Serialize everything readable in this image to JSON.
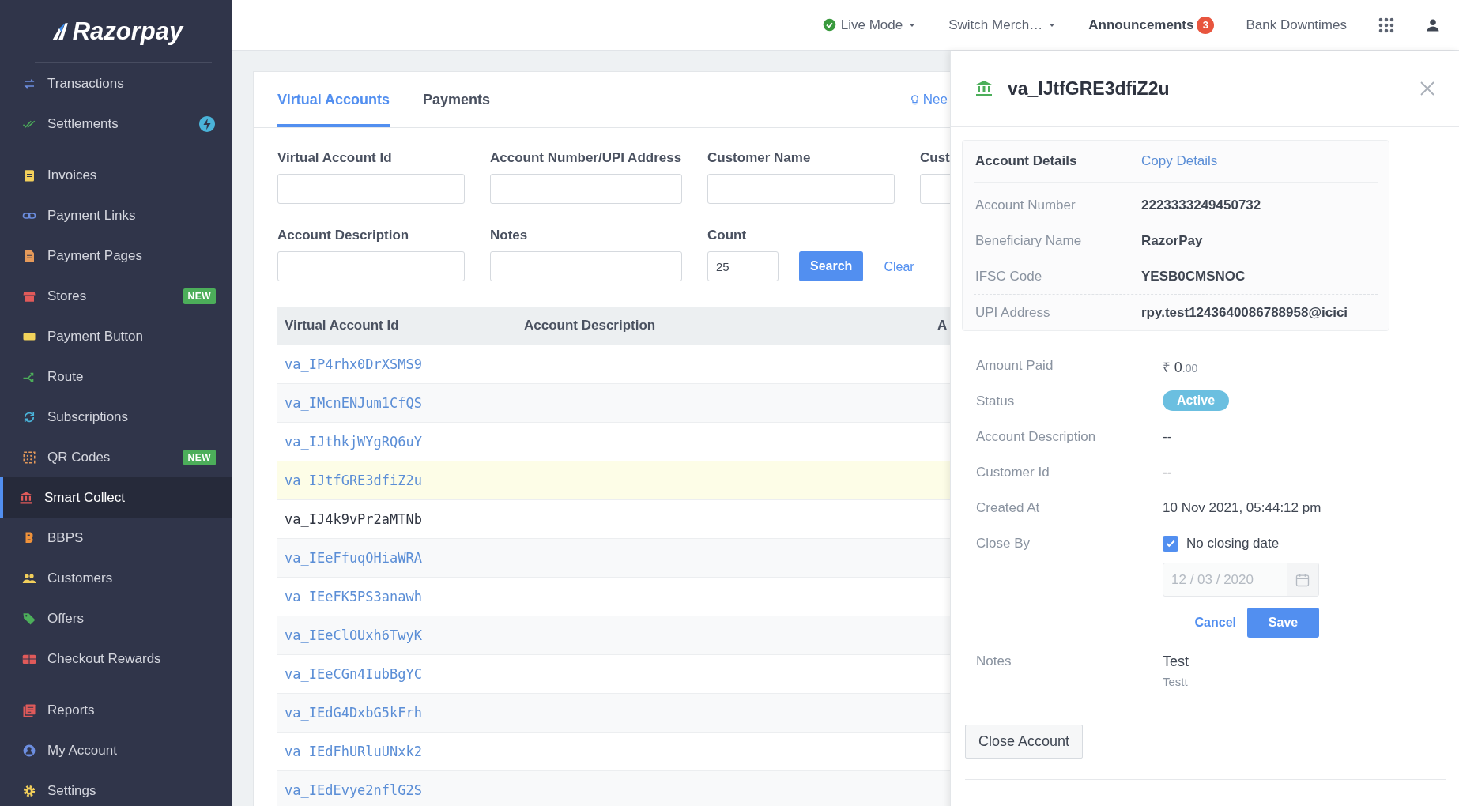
{
  "sidebar": {
    "logo": "Razorpay",
    "sections": [
      [
        {
          "label": "Transactions",
          "selected": false
        },
        {
          "label": "Settlements",
          "selected": false
        }
      ],
      [
        {
          "label": "Invoices",
          "selected": false
        },
        {
          "label": "Payment Links",
          "selected": false
        },
        {
          "label": "Payment Pages",
          "selected": false
        },
        {
          "label": "Stores",
          "badge": "NEW",
          "selected": false
        },
        {
          "label": "Payment Button",
          "selected": false
        },
        {
          "label": "Route",
          "selected": false
        },
        {
          "label": "Subscriptions",
          "selected": false
        },
        {
          "label": "QR Codes",
          "badge": "NEW",
          "selected": false
        },
        {
          "label": "Smart Collect",
          "selected": true
        },
        {
          "label": "BBPS",
          "selected": false
        },
        {
          "label": "Customers",
          "selected": false
        },
        {
          "label": "Offers",
          "selected": false
        },
        {
          "label": "Checkout Rewards",
          "selected": false
        }
      ],
      [
        {
          "label": "Reports",
          "selected": false
        },
        {
          "label": "My Account",
          "selected": false
        },
        {
          "label": "Settings",
          "selected": false
        }
      ]
    ]
  },
  "topbar": {
    "items": [
      {
        "kind": "mode",
        "label": "Live Mode"
      },
      {
        "kind": "dropdown",
        "label": "Switch Merch…"
      },
      {
        "kind": "announcements",
        "label": "Announcements",
        "count": "3"
      },
      {
        "kind": "plain",
        "label": "Bank Downtimes"
      }
    ]
  },
  "tabs": [
    {
      "label": "Virtual Accounts",
      "selected": true
    },
    {
      "label": "Payments",
      "selected": false
    }
  ],
  "help_link": "Nee",
  "filters": [
    {
      "label": "Virtual Account Id"
    },
    {
      "label": "Account Number/UPI Address"
    },
    {
      "label": "Customer Name"
    },
    {
      "label": "Cust"
    },
    {
      "label": "Account Description"
    },
    {
      "label": "Notes"
    },
    {
      "label": "Count",
      "value": "25"
    }
  ],
  "search_button": "Search",
  "clear_link": "Clear",
  "table": {
    "columns": [
      "Virtual Account Id",
      "Account Description",
      "A"
    ],
    "rows": [
      {
        "id": "va_IP4rhx0DrXSMS9",
        "kind": "link",
        "selected": false
      },
      {
        "id": "va_IMcnENJum1CfQS",
        "kind": "link",
        "selected": false
      },
      {
        "id": "va_IJthkjWYgRQ6uY",
        "kind": "link",
        "selected": false
      },
      {
        "id": "va_IJtfGRE3dfiZ2u",
        "kind": "link",
        "selected": true
      },
      {
        "id": "va_IJ4k9vPr2aMTNb",
        "kind": "text",
        "selected": false
      },
      {
        "id": "va_IEeFfuqOHiaWRA",
        "kind": "link",
        "selected": false
      },
      {
        "id": "va_IEeFK5PS3anawh",
        "kind": "link",
        "selected": false
      },
      {
        "id": "va_IEeClOUxh6TwyK",
        "kind": "link",
        "selected": false
      },
      {
        "id": "va_IEeCGn4IubBgYC",
        "kind": "link",
        "selected": false
      },
      {
        "id": "va_IEdG4DxbG5kFrh",
        "kind": "link",
        "selected": false
      },
      {
        "id": "va_IEdFhURluUNxk2",
        "kind": "link",
        "selected": false
      },
      {
        "id": "va_IEdEvye2nflG2S",
        "kind": "link",
        "selected": false
      }
    ]
  },
  "panel": {
    "title": "va_IJtfGRE3dfiZ2u",
    "account_details": {
      "heading": "Account Details",
      "copy_link": "Copy Details",
      "rows": [
        {
          "label": "Account Number",
          "value": "2223333249450732"
        },
        {
          "label": "Beneficiary Name",
          "value": "RazorPay"
        },
        {
          "label": "IFSC Code",
          "value": "YESB0CMSNOC"
        },
        {
          "label": "UPI Address",
          "value": "rpy.test1243640086788958@icici"
        }
      ]
    },
    "details": [
      {
        "kind": "amount",
        "label": "Amount Paid",
        "symbol": "₹",
        "whole": "0",
        "fraction": ".00"
      },
      {
        "kind": "badge",
        "label": "Status",
        "value": "Active"
      },
      {
        "kind": "text",
        "label": "Account Description",
        "value": "--"
      },
      {
        "kind": "text",
        "label": "Customer Id",
        "value": "--"
      },
      {
        "kind": "text",
        "label": "Created At",
        "value": "10 Nov 2021, 05:44:12 pm"
      },
      {
        "kind": "close_by",
        "label": "Close By",
        "checkbox_label": "No closing date",
        "checked": true,
        "date_value": "12 / 03 / 2020",
        "date_disabled": true,
        "cancel": "Cancel",
        "save": "Save"
      },
      {
        "kind": "notes",
        "label": "Notes",
        "key": "Test",
        "value": "Testt"
      }
    ],
    "close_button": "Close Account"
  }
}
